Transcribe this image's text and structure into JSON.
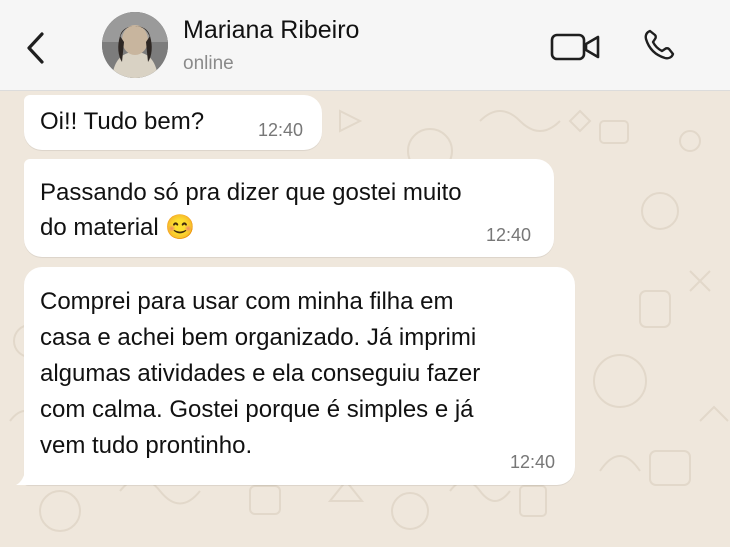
{
  "contact": {
    "name": "Mariana Ribeiro",
    "status": "online"
  },
  "icons": {
    "back": "chevron-left-icon",
    "video": "video-camera-icon",
    "call": "phone-icon"
  },
  "colors": {
    "header_bg": "#f6f6f6",
    "chat_bg": "#efe7dc",
    "bubble_bg": "#ffffff",
    "icon_color": "#1f1f1f",
    "time_color": "#777777"
  },
  "messages": [
    {
      "lines": [
        "Oi!! Tudo bem?"
      ],
      "time": "12:40"
    },
    {
      "lines": [
        "Passando só pra dizer que gostei muito",
        "do material 😊"
      ],
      "time": "12:40"
    },
    {
      "lines": [
        "Comprei para usar com minha filha em",
        "casa e achei bem organizado. Já imprimi",
        "algumas atividades e ela conseguiu fazer",
        "com calma. Gostei porque é simples e já",
        "vem tudo prontinho."
      ],
      "time": "12:40"
    }
  ]
}
